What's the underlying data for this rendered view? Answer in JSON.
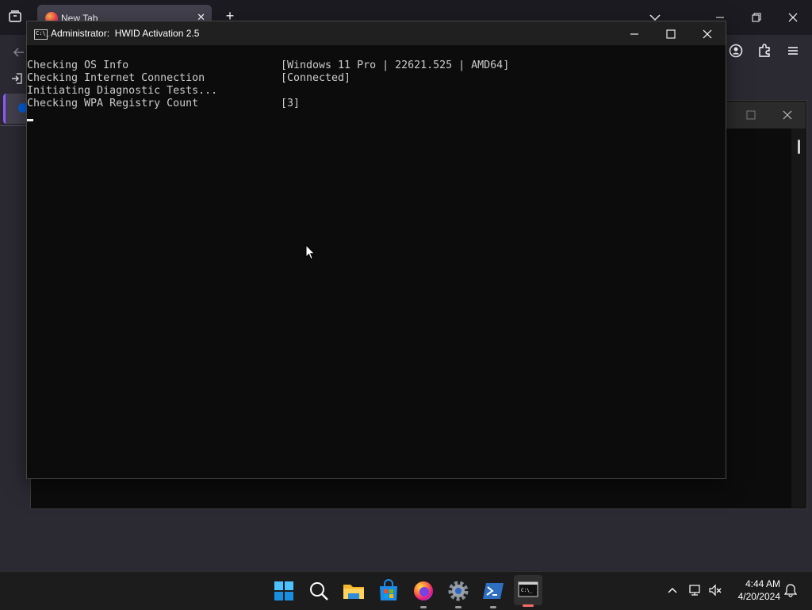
{
  "browser": {
    "tab_title": "New Tab",
    "tab_close": "✕",
    "new_tab": "+"
  },
  "cmd": {
    "title": "Administrator:  HWID Activation 2.5",
    "lines": [
      {
        "label": "Checking OS Info",
        "value": "[Windows 11 Pro | 22621.525 | AMD64]"
      },
      {
        "label": "Checking Internet Connection",
        "value": "[Connected]"
      },
      {
        "label": "Initiating Diagnostic Tests...",
        "value": ""
      },
      {
        "label": "Checking WPA Registry Count",
        "value": "[3]"
      }
    ]
  },
  "taskbar": {
    "time": "4:44 AM",
    "date": "4/20/2024",
    "apps": [
      {
        "name": "start-button",
        "icon": "windows-logo-icon"
      },
      {
        "name": "search-button",
        "icon": "search-icon"
      },
      {
        "name": "file-explorer",
        "icon": "folder-icon"
      },
      {
        "name": "microsoft-store",
        "icon": "store-icon"
      },
      {
        "name": "firefox",
        "icon": "firefox-icon"
      },
      {
        "name": "settings",
        "icon": "gear-icon"
      },
      {
        "name": "powershell",
        "icon": "powershell-icon"
      },
      {
        "name": "command-prompt",
        "icon": "terminal-icon"
      }
    ]
  },
  "colors": {
    "console_bg": "#0c0c0c",
    "console_text": "#cccccc",
    "taskbar_bg": "#1c1c1c",
    "active_indicator": "#ff6b6b"
  }
}
